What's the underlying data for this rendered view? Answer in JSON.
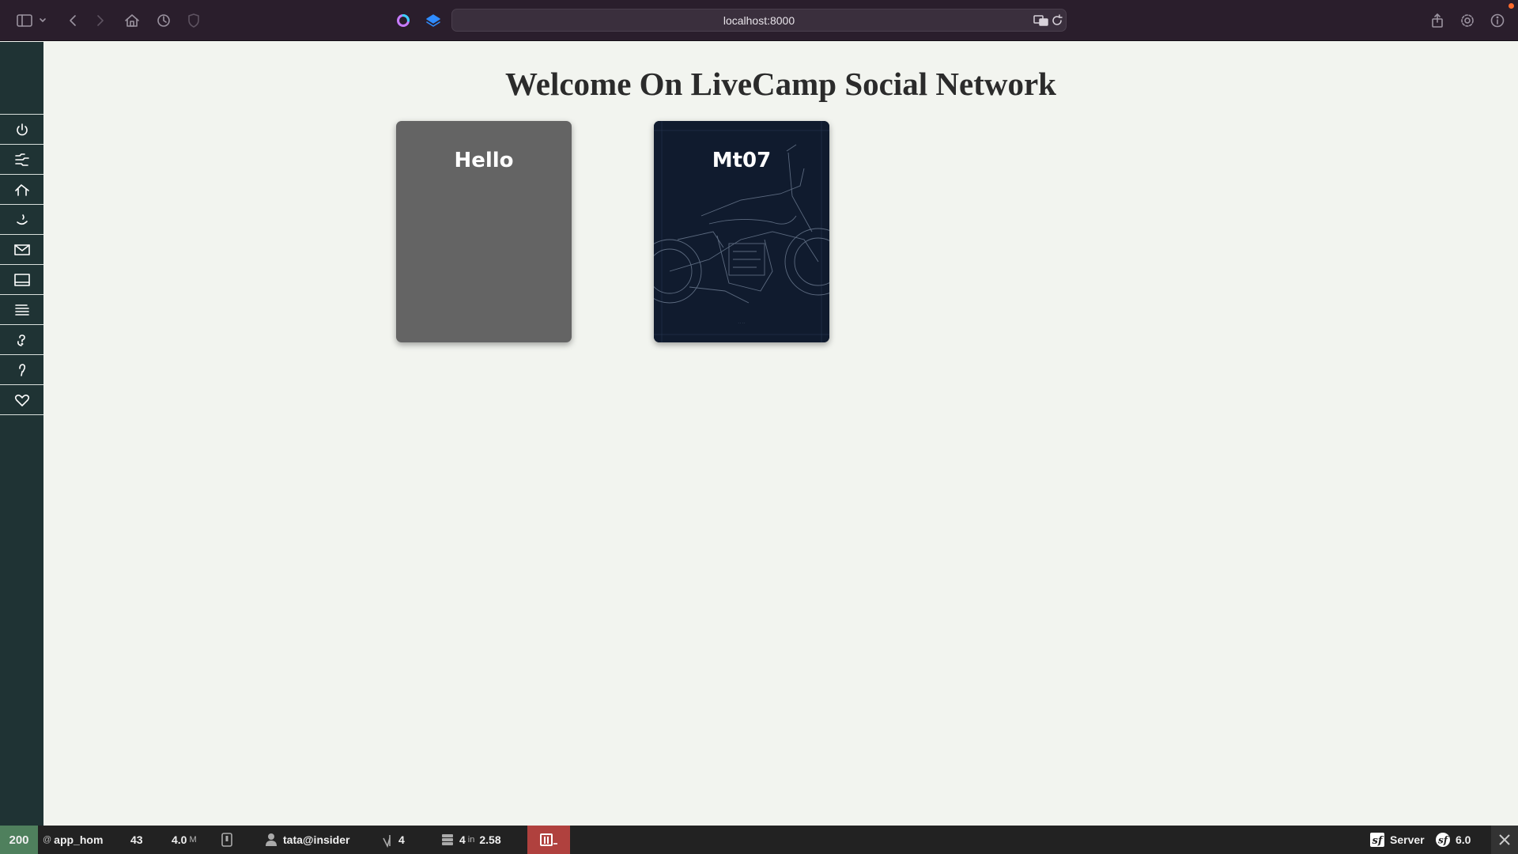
{
  "browser": {
    "url": "localhost:8000"
  },
  "page": {
    "title": "Welcome On LiveCamp Social Network",
    "cards": [
      {
        "title": "Hello",
        "background": "#646464"
      },
      {
        "title": "Mt07",
        "background": "#101b2e"
      }
    ]
  },
  "sidebar": {
    "items": [
      {
        "icon": "power-icon"
      },
      {
        "icon": "feed-icon"
      },
      {
        "icon": "home-icon"
      },
      {
        "icon": "moon-icon"
      },
      {
        "icon": "mail-icon"
      },
      {
        "icon": "image-icon"
      },
      {
        "icon": "list-icon"
      },
      {
        "icon": "help-icon"
      },
      {
        "icon": "bulb-icon"
      },
      {
        "icon": "heart-icon"
      }
    ],
    "background": "#1f3334"
  },
  "toolbar": {
    "status_code": "200",
    "route_prefix": "@",
    "route": "app_hom",
    "time": "43",
    "memory": "4.0",
    "memory_unit": "M",
    "user": "tata@insider",
    "events": "4",
    "queries": "4",
    "queries_in": "in",
    "queries_time": "2.58",
    "server_label": "Server",
    "symfony_version": "6.0",
    "status_color": "#4f805d",
    "error_color": "#b0413e"
  }
}
